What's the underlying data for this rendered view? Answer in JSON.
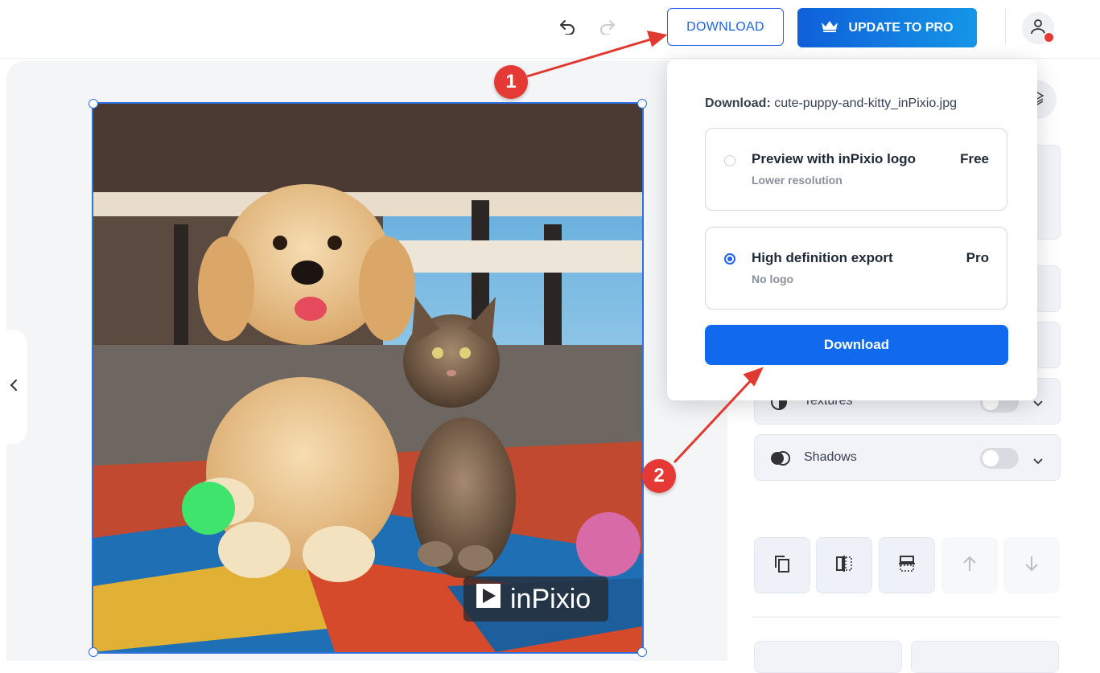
{
  "toolbar": {
    "download_label": "DOWNLOAD",
    "pro_label": "UPDATE TO PRO",
    "undo_icon": "undo-icon",
    "redo_icon": "redo-icon",
    "avatar_icon": "user-icon"
  },
  "canvas": {
    "watermark_text": "inPixio",
    "collapse_icon": "chevron-left-icon"
  },
  "popup": {
    "file_label": "Download:",
    "file_name": "cute-puppy-and-kitty_inPixio.jpg",
    "options": [
      {
        "title": "Preview with inPixio logo",
        "subtitle": "Lower resolution",
        "price": "Free",
        "selected": false
      },
      {
        "title": "High definition export",
        "subtitle": "No logo",
        "price": "Pro",
        "selected": true
      }
    ],
    "download_button": "Download"
  },
  "panel": {
    "textures_label": "Textures",
    "shadows_label": "Shadows"
  },
  "annotations": {
    "step1": "1",
    "step2": "2"
  },
  "colors": {
    "accent": "#1169ee",
    "annotation": "#e53935"
  }
}
